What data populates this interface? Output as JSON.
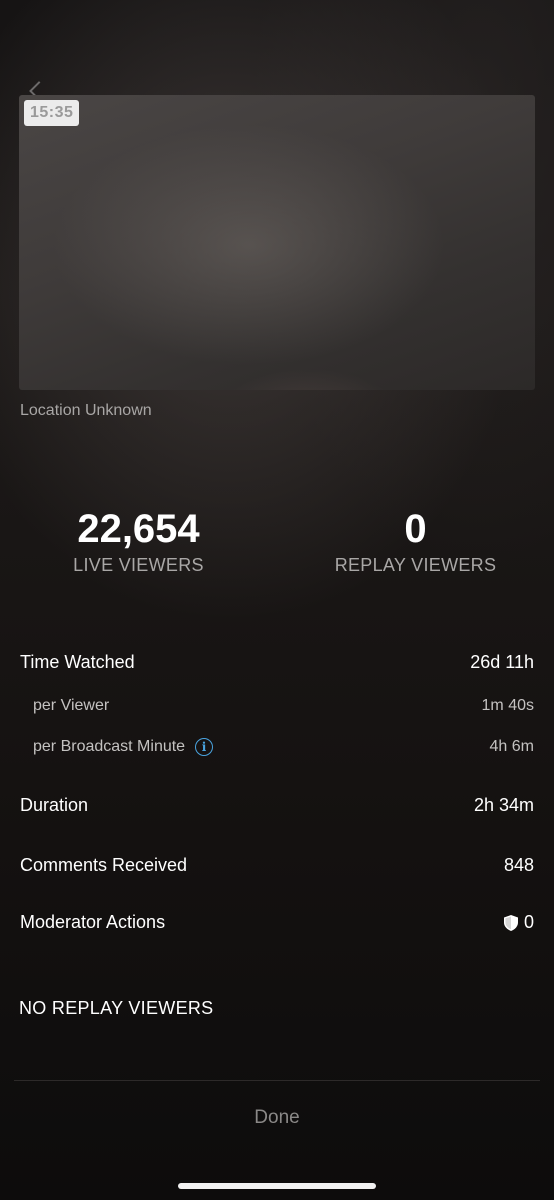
{
  "thumbnail": {
    "time_badge": "15:35"
  },
  "location": "Location Unknown",
  "stats": {
    "live": {
      "value": "22,654",
      "label": "LIVE VIEWERS"
    },
    "replay": {
      "value": "0",
      "label": "REPLAY VIEWERS"
    }
  },
  "metrics": {
    "time_watched": {
      "label": "Time Watched",
      "value": "26d 11h"
    },
    "per_viewer": {
      "label": "per Viewer",
      "value": "1m 40s"
    },
    "per_broadcast_minute": {
      "label": "per Broadcast Minute",
      "value": "4h 6m"
    },
    "duration": {
      "label": "Duration",
      "value": "2h 34m"
    },
    "comments": {
      "label": "Comments Received",
      "value": "848"
    },
    "moderator": {
      "label": "Moderator Actions",
      "value": "0"
    }
  },
  "icons": {
    "info": "info-icon",
    "shield": "shield-icon",
    "back": "chevron-left-icon"
  },
  "section_title": "NO REPLAY VIEWERS",
  "done_label": "Done",
  "colors": {
    "info_accent": "#4aa3df",
    "done_text": "#8a8887"
  }
}
